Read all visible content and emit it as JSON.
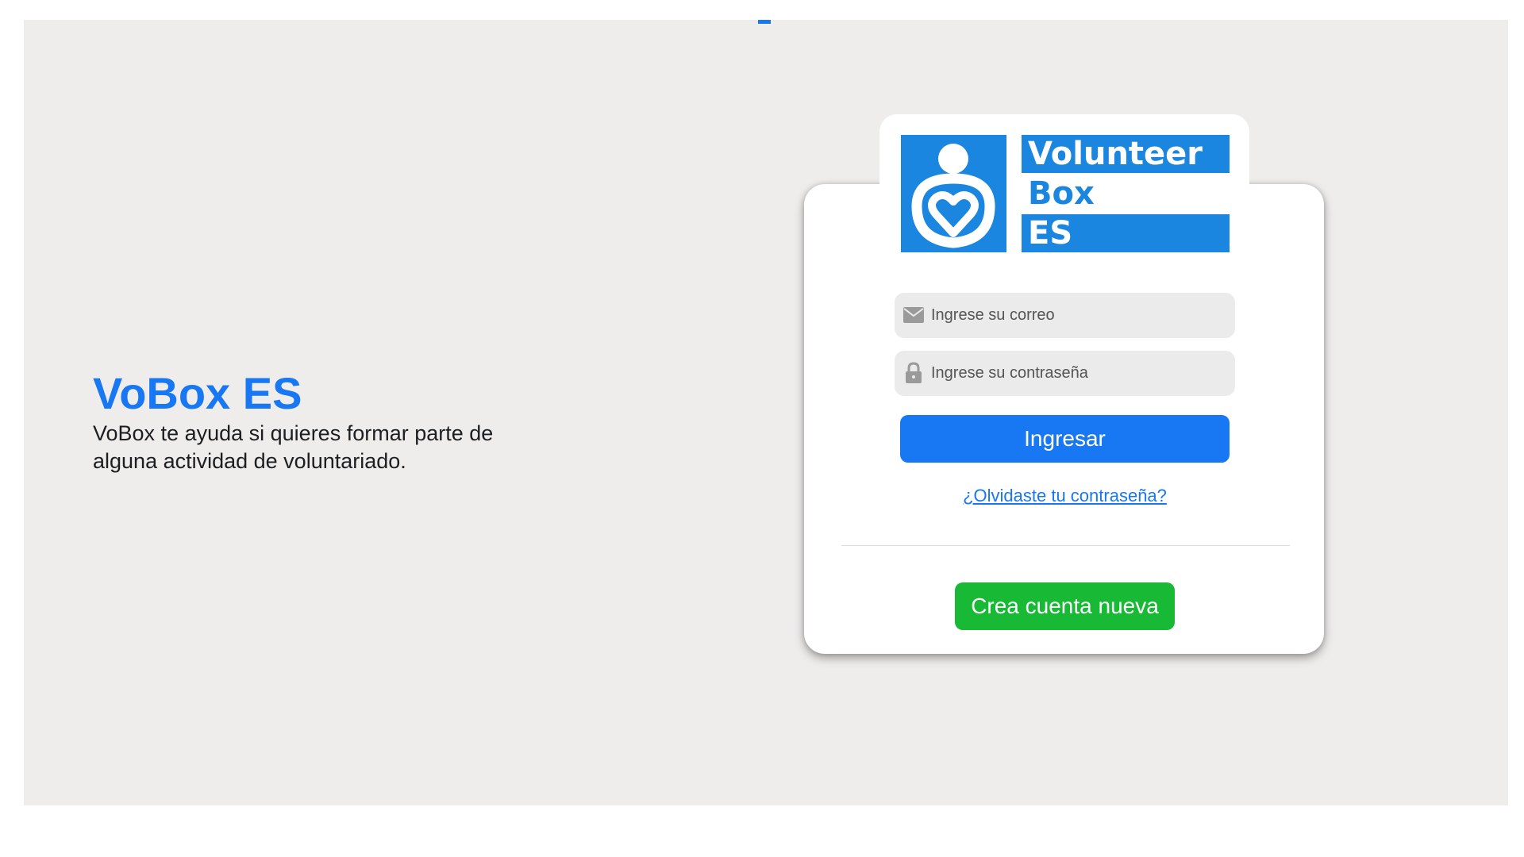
{
  "app": {
    "name": "VoBox ES",
    "tagline": "VoBox te ayuda si quieres formar parte de alguna actividad de voluntariado."
  },
  "logo": {
    "word1": "Volunteer",
    "word2": "Box",
    "word3": "ES",
    "brand_color": "#1a86e0",
    "icon": "volunteer-heart-icon"
  },
  "login": {
    "email_placeholder": "Ingrese su correo",
    "email_value": "",
    "email_icon": "envelope-icon",
    "password_placeholder": "Ingrese su contraseña",
    "password_value": "",
    "password_icon": "lock-icon",
    "submit_label": "Ingresar",
    "forgot_label": "¿Olvidaste tu contraseña?",
    "create_label": "Crea cuenta nueva"
  },
  "colors": {
    "primary": "#1877f2",
    "success": "#18b935",
    "background": "#eeedec"
  }
}
